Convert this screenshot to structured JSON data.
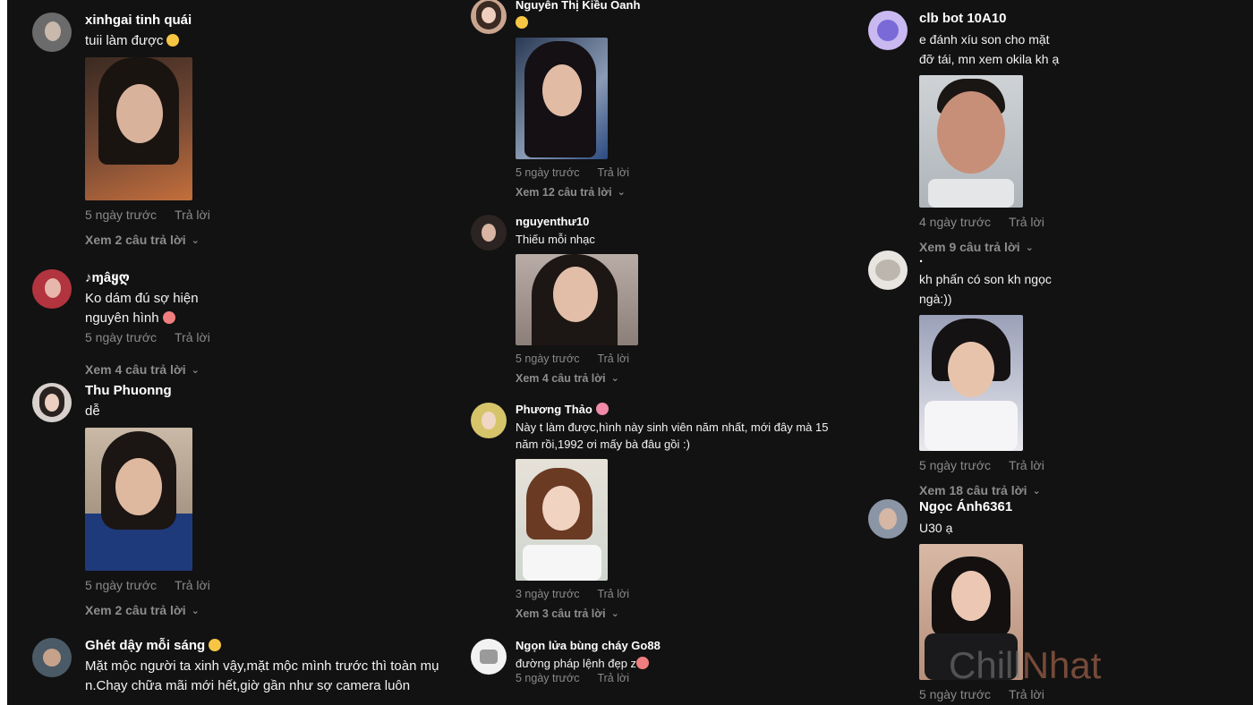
{
  "colors": {
    "background": "#121212",
    "name": "#ffffff",
    "meta": "#8a8a8a",
    "watermark": "#808080"
  },
  "actions": {
    "reply": "Trả lời"
  },
  "columns": [
    [
      {
        "name": "xinhgai tinh quái",
        "text": "tuii làm được",
        "emoji": "smile",
        "time": "5 ngày trước",
        "replies": "Xem 2 câu trả lời"
      },
      {
        "name": "♪ɱâყღ",
        "text": "Ko dám đú sợ hiện nguyên hình",
        "emoji": "heart-eyes",
        "time": "5 ngày trước",
        "replies": "Xem 4 câu trả lời"
      },
      {
        "name": "Thu Phuonng",
        "text": "dễ",
        "time": "5 ngày trước",
        "replies": "Xem 2 câu trả lời"
      },
      {
        "name": "Ghét dậy mỗi sáng",
        "emoji": "laugh",
        "text": "Mặt mộc người ta xinh vậy,mặt mộc mình trước thì toàn mụ n.Chạy chữa mãi mới hết,giờ gần như sợ camera luôn"
      }
    ],
    [
      {
        "name": "Nguyễn Thị Kiều Oanh",
        "text": "",
        "emoji": "hush",
        "time": "5 ngày trước",
        "replies": "Xem 12 câu trả lời"
      },
      {
        "name": "nguyenthư10",
        "text": "Thiếu mỗi nhạc",
        "time": "5 ngày trước",
        "replies": "Xem 4 câu trả lời"
      },
      {
        "name": "Phương Thảo",
        "emoji": "flower",
        "text": "Này t làm được,hình này sinh viên năm nhất, mới đây mà 15 năm rồi,1992 ơi mấy bà đâu gồi :)",
        "time": "3 ngày trước",
        "replies": "Xem 3 câu trả lời"
      },
      {
        "name": "Ngọn lửa bùng cháy Go88",
        "text": "đường pháp lệnh đẹp z",
        "emoji": "heart-eyes",
        "time": "5 ngày trước"
      }
    ],
    [
      {
        "name": "clb bot 10A10",
        "text": "e đánh xíu son cho mặt đỡ tái, mn xem okila kh ạ",
        "time": "4 ngày trước",
        "replies": "Xem 9 câu trả lời"
      },
      {
        "name": ".",
        "text": "kh phấn có son kh ngọc ngà:))",
        "time": "5 ngày trước",
        "replies": "Xem 18 câu trả lời"
      },
      {
        "name": "Ngọc Ánh6361",
        "text": "U30 ạ",
        "time": "5 ngày trước"
      }
    ]
  ],
  "watermark": {
    "part1": "Chill",
    "part2": "Nhat"
  }
}
